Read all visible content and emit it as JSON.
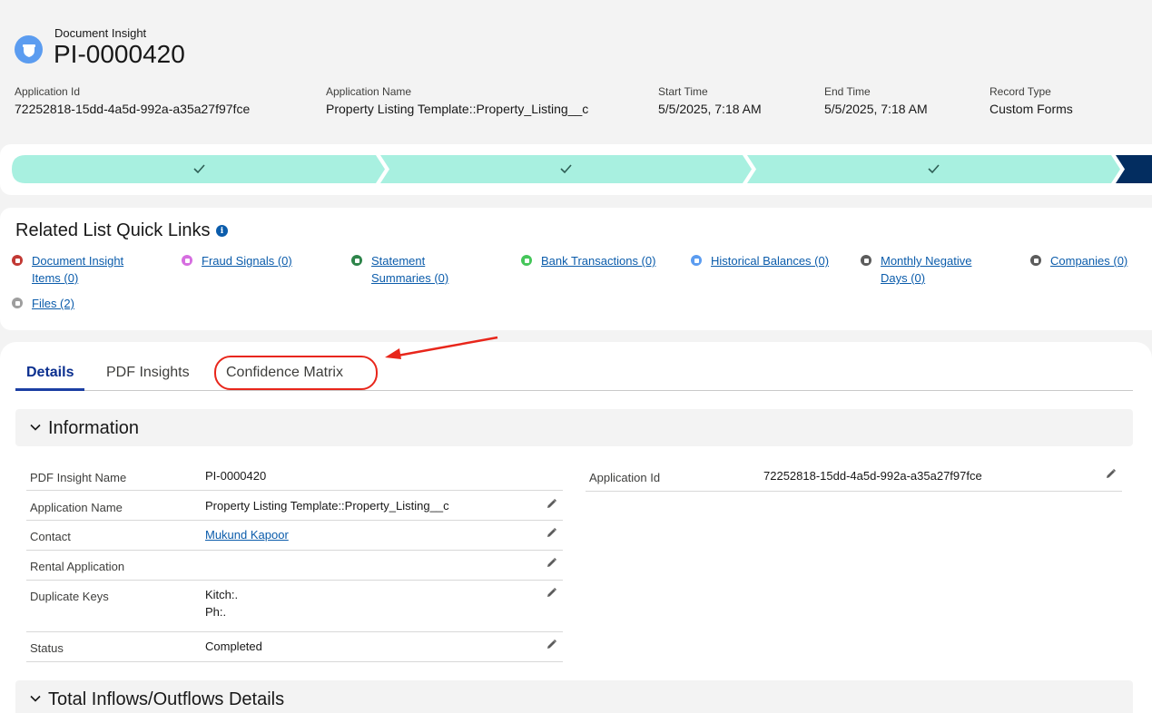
{
  "header": {
    "object_label": "Document Insight",
    "record_title": "PI-0000420",
    "fields": [
      {
        "label": "Application Id",
        "value": "72252818-15dd-4a5d-992a-a35a27f97fce"
      },
      {
        "label": "Application Name",
        "value": "Property Listing Template::Property_Listing__c"
      },
      {
        "label": "Start Time",
        "value": "5/5/2025, 7:18 AM"
      },
      {
        "label": "End Time",
        "value": "5/5/2025, 7:18 AM"
      },
      {
        "label": "Record Type",
        "value": "Custom Forms"
      }
    ]
  },
  "path": {
    "completed_color": "#a8f0e0",
    "current_color": "#032d60"
  },
  "quick_links": {
    "title": "Related List Quick Links",
    "info_icon": "i",
    "items": [
      {
        "label_line1": "Document Insight",
        "label_line2": "Items (0)",
        "color": "#c23934",
        "icon": "triangle-icon"
      },
      {
        "label_line1": "Fraud Signals (0)",
        "label_line2": "",
        "color": "#d66ee0",
        "icon": "calendar-icon"
      },
      {
        "label_line1": "Statement",
        "label_line2": "Summaries (0)",
        "color": "#2e844a",
        "icon": "note-icon"
      },
      {
        "label_line1": "Bank Transactions (0)",
        "label_line2": "",
        "color": "#45c65a",
        "icon": "table-icon"
      },
      {
        "label_line1": "Historical Balances (0)",
        "label_line2": "",
        "color": "#5b9cf0",
        "icon": "globe-icon"
      },
      {
        "label_line1": "Monthly Negative",
        "label_line2": "Days (0)",
        "color": "#5c5c5c",
        "icon": "wrench-icon"
      },
      {
        "label_line1": "Companies (0)",
        "label_line2": "",
        "color": "#5c5c5c",
        "icon": "wrench-icon"
      },
      {
        "label_line1": "Files (2)",
        "label_line2": "",
        "color": "#9e9e9e",
        "icon": "files-icon"
      }
    ]
  },
  "tabs": {
    "details": "Details",
    "pdf_insights": "PDF Insights",
    "confidence_matrix": "Confidence Matrix"
  },
  "information": {
    "title": "Information",
    "left_rows": [
      {
        "label": "PDF Insight Name",
        "value": "PI-0000420"
      },
      {
        "label": "Application Name",
        "value": "Property Listing Template::Property_Listing__c"
      },
      {
        "label": "Contact",
        "value": "Mukund Kapoor"
      },
      {
        "label": "Rental Application",
        "value": ""
      },
      {
        "label": "Duplicate Keys",
        "value_line1": "Kitch:.",
        "value_line2": "Ph:."
      },
      {
        "label": "Status",
        "value": "Completed"
      }
    ],
    "right_rows": [
      {
        "label": "Application Id",
        "value": "72252818-15dd-4a5d-992a-a35a27f97fce"
      }
    ]
  },
  "inflows_section": {
    "title": "Total Inflows/Outflows Details"
  }
}
